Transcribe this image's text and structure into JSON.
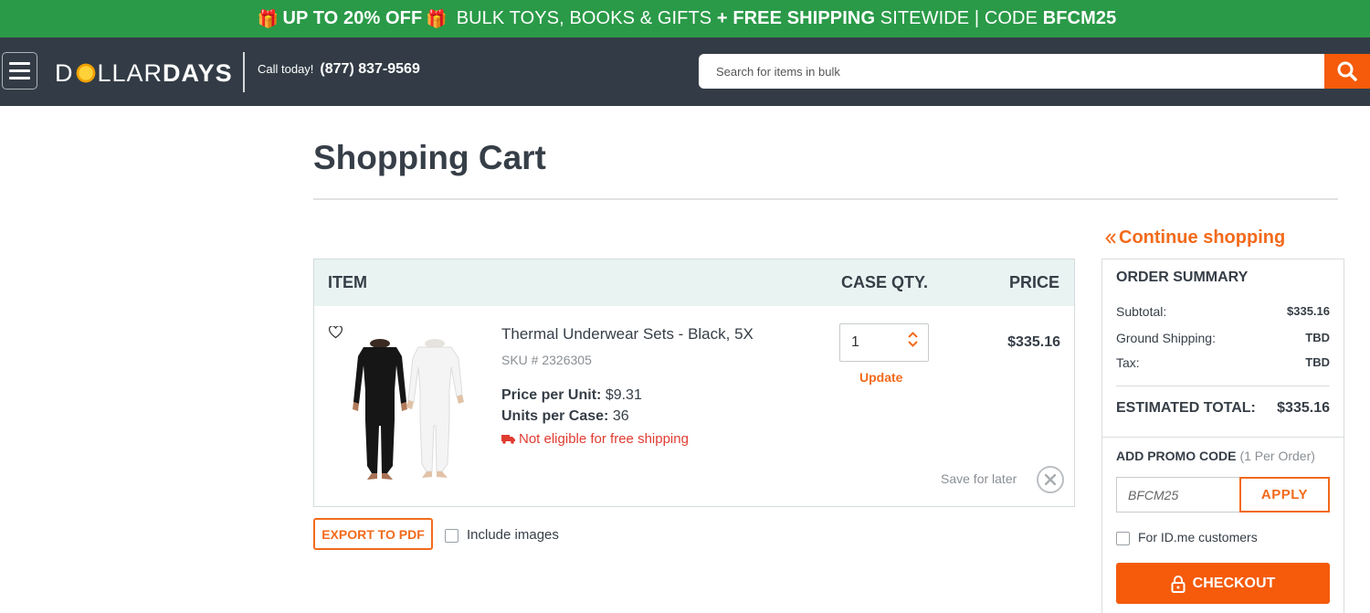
{
  "promo_bar": {
    "gift_icon": "gift-icon",
    "part1": "UP TO 20% OFF",
    "part2": " BULK TOYS, BOOKS & GIFTS ",
    "part3": "+ FREE SHIPPING",
    "part4": " SITEWIDE | CODE ",
    "code": "BFCM25",
    "bg_color": "#2a9a48"
  },
  "header": {
    "menu_icon": "hamburger-menu-icon",
    "logo": {
      "light_pre": "D",
      "light_post": "LLAR",
      "bold": "DAYS"
    },
    "call_label": "Call today!",
    "phone": "(877) 837-9569",
    "search_placeholder": "Search for items in bulk",
    "search_icon": "search-icon",
    "bg_color": "#333c46",
    "accent_color": "#f55b0a"
  },
  "page": {
    "title": "Shopping Cart"
  },
  "cart": {
    "headers": {
      "item": "ITEM",
      "qty": "CASE QTY.",
      "price": "PRICE"
    },
    "items": [
      {
        "name": "Thermal Underwear Sets - Black, 5X",
        "sku": "SKU # 2326305",
        "price_per_unit_label": "Price per Unit:",
        "price_per_unit": "$9.31",
        "units_per_case_label": "Units per Case:",
        "units_per_case": "36",
        "shipping_note": "Not eligible for free shipping",
        "quantity": "1",
        "update_label": "Update",
        "price": "$335.16",
        "save_for_later": "Save for later"
      }
    ],
    "export_label": "EXPORT TO PDF",
    "include_images_label": "Include images"
  },
  "sidebar": {
    "continue_label": "Continue shopping",
    "summary": {
      "title": "ORDER SUMMARY",
      "subtotal_label": "Subtotal:",
      "subtotal": "$335.16",
      "shipping_label": "Ground Shipping:",
      "shipping": "TBD",
      "tax_label": "Tax:",
      "tax": "TBD",
      "total_label": "ESTIMATED TOTAL:",
      "total": "$335.16"
    },
    "promo": {
      "title": "ADD PROMO CODE",
      "note": "(1 Per Order)",
      "value": "BFCM25",
      "apply_label": "APPLY"
    },
    "idme_label": "For ID.me customers",
    "checkout_label": "CHECKOUT"
  }
}
